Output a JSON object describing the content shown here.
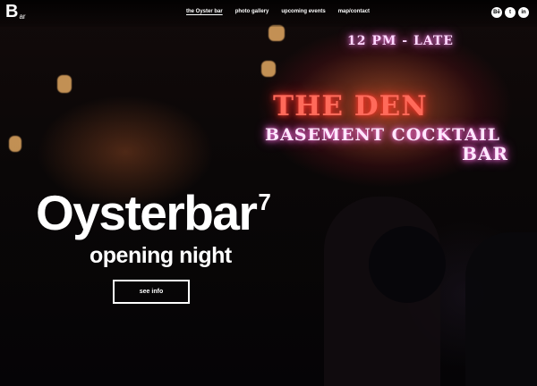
{
  "brand": {
    "logo_main": "B",
    "logo_suffix": "ar"
  },
  "nav": {
    "items": [
      {
        "label": "the Oyster bar",
        "active": true
      },
      {
        "label": "photo gallery",
        "active": false
      },
      {
        "label": "upcoming events",
        "active": false
      },
      {
        "label": "map/contact",
        "active": false
      }
    ]
  },
  "social": {
    "icons": [
      {
        "name": "behance-icon",
        "glyph": "Bē"
      },
      {
        "name": "twitter-icon",
        "glyph": "t"
      },
      {
        "name": "linkedin-icon",
        "glyph": "in"
      }
    ]
  },
  "hero": {
    "title": "Oysterbar",
    "title_sup": "7",
    "subtitle": "opening night",
    "cta_label": "see info"
  },
  "background_signage": {
    "time": "12 PM - LATE",
    "name": "THE DEN",
    "line2": "BASEMENT COCKTAIL",
    "line3": "BAR"
  },
  "colors": {
    "background": "#000000",
    "text": "#ffffff",
    "neon_pink": "#ff5ad8",
    "neon_red": "#ff3a2e"
  }
}
